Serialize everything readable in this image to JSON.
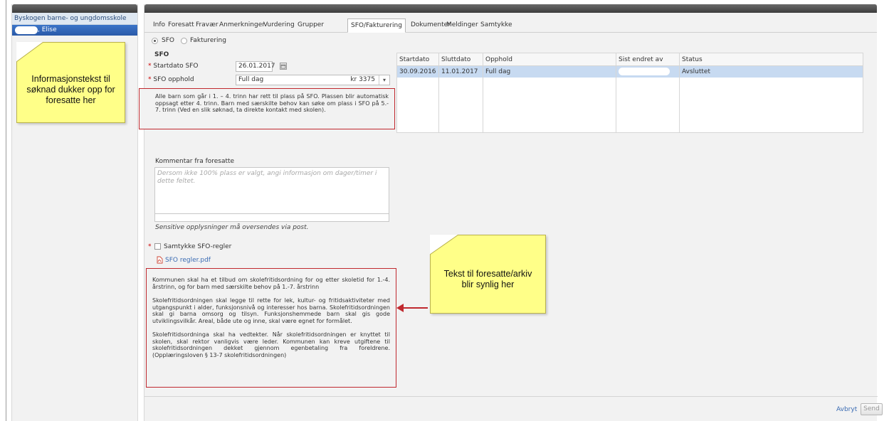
{
  "sidebar": {
    "school_name": "Byskogen barne- og ungdomsskole",
    "student_name": ", Elise"
  },
  "tabs": [
    {
      "label": "Info"
    },
    {
      "label": "Foresatt"
    },
    {
      "label": "Fravær"
    },
    {
      "label": "Anmerkninger"
    },
    {
      "label": "Vurdering"
    },
    {
      "label": "Grupper"
    },
    {
      "label": "SFO/Fakturering",
      "active": true
    },
    {
      "label": "Dokumenter"
    },
    {
      "label": "Meldinger"
    },
    {
      "label": "Samtykke"
    }
  ],
  "mode": {
    "sfo_label": "SFO",
    "fakturering_label": "Fakturering",
    "selected": "SFO"
  },
  "form": {
    "section_title": "SFO",
    "startdato_label": "Startdato SFO",
    "startdato_value": "26.01.2017",
    "opphold_label": "SFO opphold",
    "opphold_value": "Full dag",
    "opphold_price": "kr  3375",
    "info_text": "Alle barn som går i 1. – 4. trinn har rett til plass på SFO. Plassen blir automatisk oppsagt etter 4. trinn. Barn med særskilte behov kan søke om plass i SFO på 5.- 7. trinn (Ved en slik søknad, ta direkte kontakt med skolen).",
    "comment_label": "Kommentar fra foresatte",
    "comment_placeholder": "Dersom ikke 100% plass er valgt, angi informasjon om dager/timer i dette feltet.",
    "sensitive_note": "Sensitive opplysninger må oversendes via post.",
    "consent_label": "Samtykke SFO-regler",
    "rules_link": "SFO regler.pdf",
    "archive_p1": "Kommunen skal ha et tilbud om skolefritidsordning for og etter skoletid for 1.-4. årstrinn, og for barn med særskilte behov på 1.-7. årstrinn",
    "archive_p2": "Skolefritidsordningen skal legge til rette for lek, kultur- og fritidsaktiviteter med utgangspunkt i alder, funksjonsnivå og interesser hos barna. Skolefritidsordningen skal gi barna omsorg og tilsyn. Funksjonshemmede barn skal gis gode utviklingsvilkår. Areal, både ute og inne, skal være egnet for formålet.",
    "archive_p3": "Skolefritidsordninga skal ha vedtekter. Når skolefritidsordningen er knyttet til skolen, skal rektor vanligvis være leder. Kommunen kan kreve utgiftene til skolefritidsordningen dekket gjennom egenbetaling fra foreldrene. (Opplæringsloven § 13-7 skolefritidsordningen)"
  },
  "table": {
    "headers": [
      "Startdato",
      "Sluttdato",
      "Opphold",
      "Sist endret av",
      "Status"
    ],
    "rows": [
      {
        "startdato": "30.09.2016",
        "sluttdato": "11.01.2017",
        "opphold": "Full dag",
        "endret_av": "",
        "status": "Avsluttet"
      }
    ]
  },
  "footer": {
    "cancel_label": "Avbryt",
    "send_label": "Send"
  },
  "annotations": {
    "note1": "Informasjonstekst til søknad dukker opp for foresatte her",
    "note2": "Tekst til foresatte/arkiv blir synlig her"
  },
  "colors": {
    "accent_blue": "#2a5aa8",
    "selected_row": "#c7daf1",
    "annotation_red": "#c0292f",
    "note_yellow": "#ffff88"
  }
}
